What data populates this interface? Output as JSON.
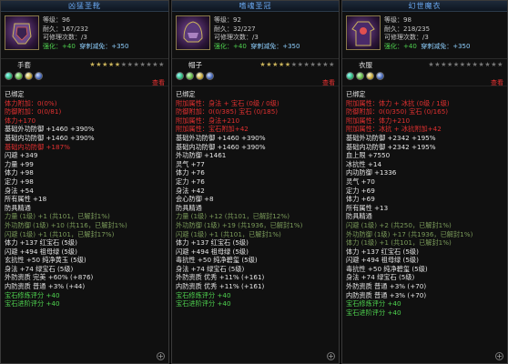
{
  "panels": [
    {
      "title": "凶猛圣靴",
      "stats": [
        "等级：96",
        "耐久：167/232",
        "可修理次数：/3"
      ],
      "stat_green": "强化：+40",
      "stat_blue": "穿刺减免：+350",
      "slot": "手套",
      "stars_lit": 5,
      "stars_total": 12,
      "detail": "查看",
      "lines": [
        {
          "t": "已绑定",
          "c": "w"
        },
        {
          "t": "体力附加：0(0%)",
          "c": "r"
        },
        {
          "t": "防御附加：0(0/81)",
          "c": "r"
        },
        {
          "t": "体力+170",
          "c": "r"
        },
        {
          "t": "基础外功防御 +1460 +390%",
          "c": "w"
        },
        {
          "t": "基础内功防御 +1460 +390%",
          "c": "w"
        },
        {
          "t": "基础内功防御 +187%",
          "c": "r"
        },
        {
          "t": "闪避 +349",
          "c": "w"
        },
        {
          "t": "力量 +99",
          "c": "w"
        },
        {
          "t": "体力 +98",
          "c": "w"
        },
        {
          "t": "定力 +98",
          "c": "w"
        },
        {
          "t": "身法 +54",
          "c": "w"
        },
        {
          "t": "所有属性 +18",
          "c": "w"
        },
        {
          "t": "防具精通",
          "c": "w"
        },
        {
          "t": "力量 (1级) +1 (共101，已解封1%)",
          "c": "gr"
        },
        {
          "t": "外功防御 (1级) +10 (共116，已解封1%)",
          "c": "gr"
        },
        {
          "t": "闪避 (1级) +1 (共101，已解封17%)",
          "c": "gr"
        },
        {
          "t": "体力 +137 红宝石 (5级)",
          "c": "w"
        },
        {
          "t": "闪避 +494 祖母绿 (5级)",
          "c": "w"
        },
        {
          "t": "玄抗性 +50 纯净黄玉 (5级)",
          "c": "w"
        },
        {
          "t": "身法 +74 绿宝石 (5级)",
          "c": "w"
        },
        {
          "t": "外防资质 完美 +60% (+876)",
          "c": "w"
        },
        {
          "t": "内防资质 普通 +3% (+44)",
          "c": "w"
        },
        {
          "t": "宝石修炼评分 +40",
          "c": "g"
        },
        {
          "t": "宝石进阶评分 +40",
          "c": "g"
        }
      ]
    },
    {
      "title": "嗜魂圣冠",
      "stats": [
        "等级：92",
        "耐久：32/227",
        "可修理次数：/3"
      ],
      "stat_green": "强化：+40",
      "stat_blue": "穿刺减免：+350",
      "slot": "帽子",
      "stars_lit": 5,
      "stars_total": 12,
      "detail": "查看",
      "lines": [
        {
          "t": "已绑定",
          "c": "w"
        },
        {
          "t": "附加属性：身法 + 宝石 (0级 / 0级)",
          "c": "r"
        },
        {
          "t": "防御附加：0(0/385) 宝石 (0/185)",
          "c": "r"
        },
        {
          "t": "附加属性：身法+210",
          "c": "r"
        },
        {
          "t": "附加属性：宝石附加+42",
          "c": "r"
        },
        {
          "t": "基础外功防御 +1460 +390%",
          "c": "w"
        },
        {
          "t": "基础内功防御 +1460 +390%",
          "c": "w"
        },
        {
          "t": "外功防御 +1461",
          "c": "w"
        },
        {
          "t": "灵气 +77",
          "c": "w"
        },
        {
          "t": "体力 +76",
          "c": "w"
        },
        {
          "t": "定力 +76",
          "c": "w"
        },
        {
          "t": "身法 +42",
          "c": "w"
        },
        {
          "t": "会心防御 +8",
          "c": "w"
        },
        {
          "t": "防具精通",
          "c": "w"
        },
        {
          "t": "力量 (1级) +12 (共101，已解封12%)",
          "c": "gr"
        },
        {
          "t": "外功防御 (1级) +19 (共1936，已解封1%)",
          "c": "gr"
        },
        {
          "t": "闪避 (1级) +1 (共101，已解封1%)",
          "c": "gr"
        },
        {
          "t": "体力 +137 红宝石 (5级)",
          "c": "w"
        },
        {
          "t": "闪避 +494 祖母绿 (5级)",
          "c": "w"
        },
        {
          "t": "毒抗性 +50 纯净碧玺 (5级)",
          "c": "w"
        },
        {
          "t": "身法 +74 绿宝石 (5级)",
          "c": "w"
        },
        {
          "t": "外防资质 优秀 +11% (+161)",
          "c": "w"
        },
        {
          "t": "内防资质 优秀 +11% (+161)",
          "c": "w"
        },
        {
          "t": "宝石修炼评分 +40",
          "c": "g"
        },
        {
          "t": "宝石进阶评分 +40",
          "c": "g"
        }
      ]
    },
    {
      "title": "幻世魔衣",
      "stats": [
        "等级：98",
        "耐久：218/235",
        "可修理次数：/3"
      ],
      "stat_green": "强化：+40",
      "stat_blue": "穿刺减免：+350",
      "slot": "衣服",
      "stars_lit": 0,
      "stars_total": 12,
      "detail": "查看",
      "lines": [
        {
          "t": "已绑定",
          "c": "w"
        },
        {
          "t": "附加属性：体力 + 冰抗 (0级 / 1级)",
          "c": "r"
        },
        {
          "t": "防御附加：0(0/350) 宝石 (0/165)",
          "c": "r"
        },
        {
          "t": "附加属性：体力+210",
          "c": "r"
        },
        {
          "t": "附加属性：冰抗 + 冰抗附加+42",
          "c": "r"
        },
        {
          "t": "基础外功防御 +2342 +195%",
          "c": "w"
        },
        {
          "t": "基础内功防御 +2342 +195%",
          "c": "w"
        },
        {
          "t": "血上限 +7550",
          "c": "w"
        },
        {
          "t": "冰抗性 +14",
          "c": "w"
        },
        {
          "t": "内功防御 +1336",
          "c": "w"
        },
        {
          "t": "灵气 +70",
          "c": "w"
        },
        {
          "t": "定力 +69",
          "c": "w"
        },
        {
          "t": "体力 +69",
          "c": "w"
        },
        {
          "t": "所有属性 +13",
          "c": "w"
        },
        {
          "t": "防具精通",
          "c": "w"
        },
        {
          "t": "闪避 (1级) +2 (共250，已解封1%)",
          "c": "gr"
        },
        {
          "t": "外功防御 (1级) +17 (共1936，已解封1%)",
          "c": "gr"
        },
        {
          "t": "体力 (1级) +1 (共101，已解封1%)",
          "c": "gr"
        },
        {
          "t": "体力 +137 红宝石 (5级)",
          "c": "w"
        },
        {
          "t": "闪避 +494 祖母绿 (5级)",
          "c": "w"
        },
        {
          "t": "毒抗性 +50 纯净碧玺 (5级)",
          "c": "w"
        },
        {
          "t": "身法 +74 绿宝石 (5级)",
          "c": "w"
        },
        {
          "t": "外防资质 普通 +3% (+70)",
          "c": "w"
        },
        {
          "t": "内防资质 普通 +3% (+70)",
          "c": "w"
        },
        {
          "t": "宝石修炼评分 +40",
          "c": "g"
        },
        {
          "t": "宝石进阶评分 +40",
          "c": "g"
        }
      ]
    }
  ],
  "icons": {
    "boots": "gauntlet-icon",
    "helm": "helmet-icon",
    "robe": "robe-icon",
    "gem": "gem-icon",
    "expand": "plus-icon",
    "star": "star-icon"
  }
}
